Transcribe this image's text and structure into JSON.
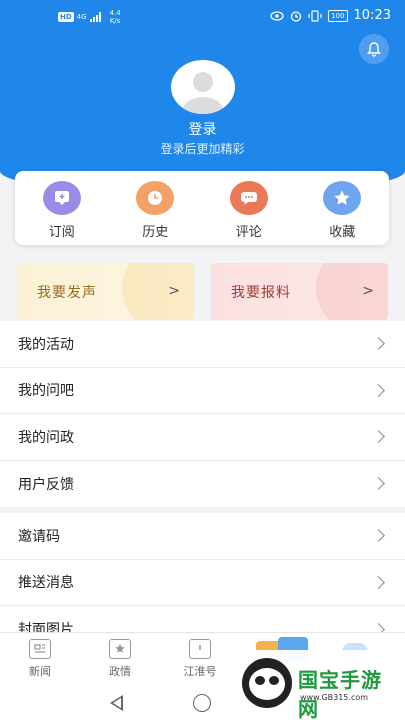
{
  "status_bar": {
    "network": "4G",
    "speed_value": "4.4",
    "speed_unit": "K/s",
    "battery": "100",
    "time": "10:23"
  },
  "profile": {
    "login_label": "登录",
    "login_hint": "登录后更加精彩"
  },
  "quick_actions": [
    {
      "label": "订阅",
      "icon": "subscribe-icon",
      "color": "#9b8be6"
    },
    {
      "label": "历史",
      "icon": "history-icon",
      "color": "#f2a266"
    },
    {
      "label": "评论",
      "icon": "comment-icon",
      "color": "#ec7955"
    },
    {
      "label": "收藏",
      "icon": "star-icon",
      "color": "#6fa5ee"
    }
  ],
  "action_cards": {
    "voice_label": "我要发声",
    "report_label": "我要报料"
  },
  "menu_group_1": [
    {
      "label": "我的活动"
    },
    {
      "label": "我的问吧"
    },
    {
      "label": "我的问政"
    },
    {
      "label": "用户反馈"
    }
  ],
  "menu_group_2": [
    {
      "label": "邀请码"
    },
    {
      "label": "推送消息"
    },
    {
      "label": "封面图片"
    }
  ],
  "bottom_nav": [
    {
      "label": "新闻",
      "icon": "news-icon"
    },
    {
      "label": "政情",
      "icon": "politics-icon"
    },
    {
      "label": "江淮号",
      "icon": "jianghuai-icon"
    }
  ],
  "watermark": {
    "title": "国宝手游网",
    "url": "www.GB315.com"
  },
  "colors": {
    "header_blue": "#1f86ea"
  }
}
